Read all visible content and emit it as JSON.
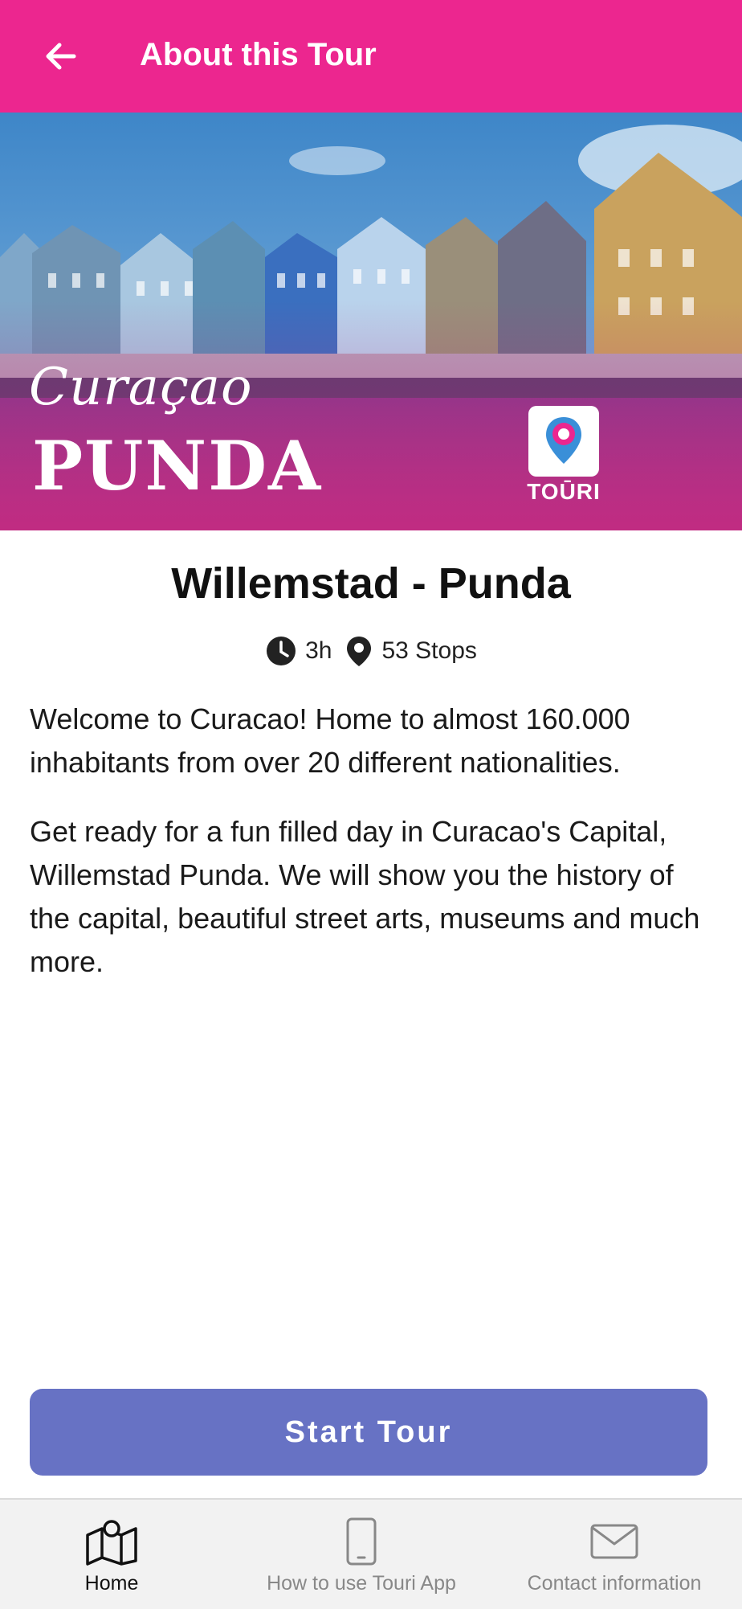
{
  "appbar": {
    "title": "About this Tour"
  },
  "hero": {
    "script_text": "Curaçao",
    "big_text": "PUNDA",
    "logo_text": "TOŪRI"
  },
  "tour": {
    "title": "Willemstad - Punda",
    "duration": "3h",
    "stops": "53 Stops",
    "description": [
      "Welcome to Curacao! Home to almost 160.000 inhabitants from over 20 different nationalities.",
      "Get ready for a fun filled day in Curacao's Capital, Willemstad Punda. We will show you the history of the capital, beautiful street arts, museums and much more."
    ]
  },
  "actions": {
    "start_label": "Start Tour"
  },
  "nav": {
    "items": [
      {
        "label": "Home",
        "icon": "map-icon",
        "active": true
      },
      {
        "label": "How to use Touri App",
        "icon": "phone-icon",
        "active": false
      },
      {
        "label": "Contact information",
        "icon": "envelope-icon",
        "active": false
      }
    ]
  },
  "colors": {
    "appbar": "#ec268f",
    "start_button": "#6772c4",
    "nav_background": "#f2f2f2"
  }
}
